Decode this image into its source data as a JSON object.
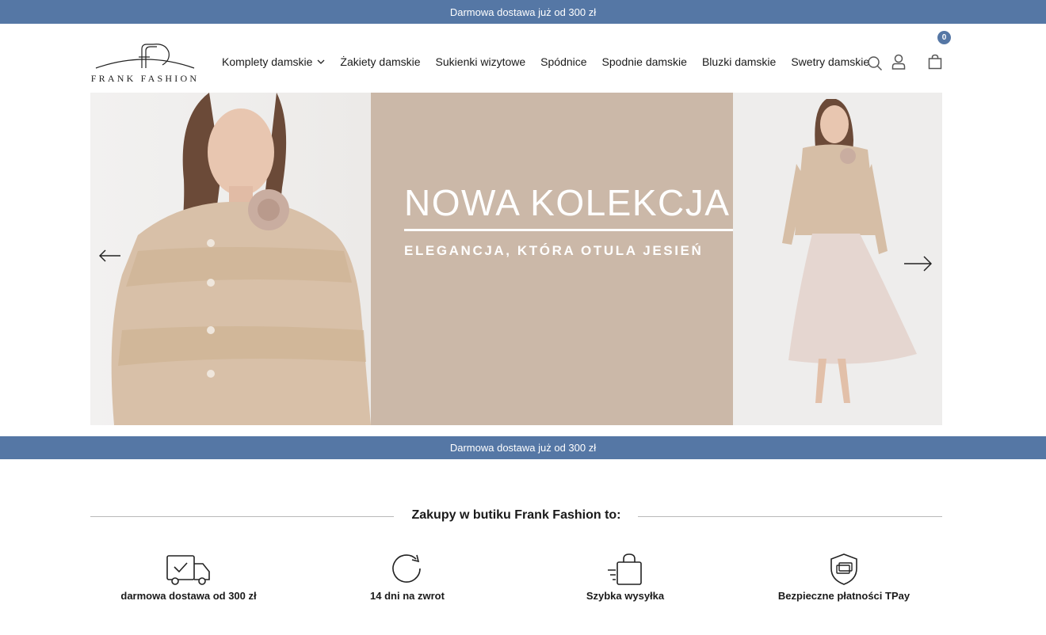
{
  "announcement_top": "Darmowa dostawa już od 300 zł",
  "announcement_bottom": "Darmowa dostawa już od 300 zł",
  "logo": {
    "text": "FRANK FASHION"
  },
  "nav": [
    {
      "label": "Komplety damskie",
      "has_dropdown": true
    },
    {
      "label": "Żakiety damskie"
    },
    {
      "label": "Sukienki wizytowe"
    },
    {
      "label": "Spódnice"
    },
    {
      "label": "Spodnie damskie"
    },
    {
      "label": "Bluzki damskie"
    },
    {
      "label": "Swetry damskie"
    }
  ],
  "header_icons": [
    "search-icon",
    "account-icon",
    "cart-icon"
  ],
  "cart_count": "0",
  "hero": {
    "title": "NOWA KOLEKCJA",
    "subtitle": "ELEGANCJA, KTÓRA OTULA JESIEŃ"
  },
  "benefits": {
    "title": "Zakupy w butiku Frank Fashion to:",
    "items": [
      {
        "icon": "delivery-truck-icon",
        "label": "darmowa dostawa od 300 zł"
      },
      {
        "icon": "return-icon",
        "label": "14 dni na zwrot"
      },
      {
        "icon": "fast-shipping-bag-icon",
        "label": "Szybka wysyłka"
      },
      {
        "icon": "secure-payment-shield-icon",
        "label": "Bezpieczne płatności TPay"
      }
    ]
  },
  "colors": {
    "accent": "#5577a5",
    "hero_panel": "#cbb8a8"
  }
}
